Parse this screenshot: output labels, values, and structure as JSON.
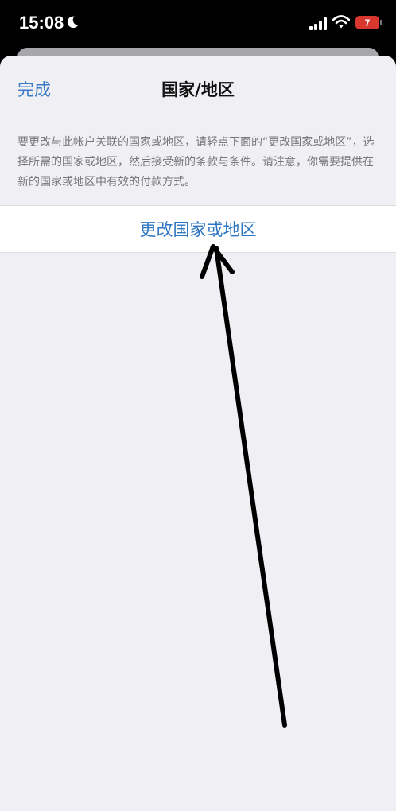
{
  "status_bar": {
    "time": "15:08",
    "battery_level": "7",
    "icons": [
      "moon-icon",
      "cellular-signal-icon",
      "wifi-icon",
      "battery-icon"
    ]
  },
  "sheet": {
    "done_label": "完成",
    "title": "国家/地区",
    "description": "要更改与此帐户关联的国家或地区，请轻点下面的“更改国家或地区”，选择所需的国家或地区，然后接受新的条款与条件。请注意，你需要提供在新的国家或地区中有效的付款方式。",
    "change_button_label": "更改国家或地区"
  },
  "annotation": {
    "type": "hand-drawn arrow",
    "color": "#000000"
  },
  "colors": {
    "accent": "#2f76c2",
    "sheet_background": "#f0f0f4",
    "battery_low": "#d9372e"
  }
}
